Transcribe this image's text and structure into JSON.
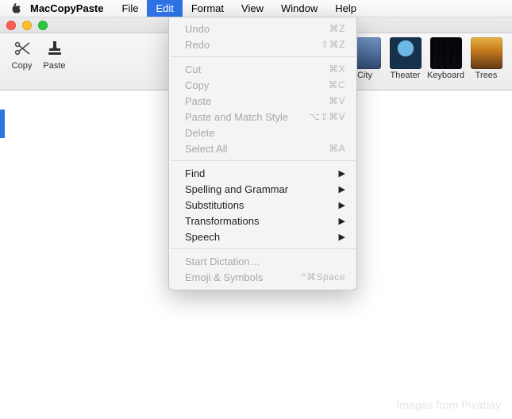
{
  "menubar": {
    "app_name": "MacCopyPaste",
    "items": [
      "File",
      "Edit",
      "Format",
      "View",
      "Window",
      "Help"
    ],
    "active_index": 1
  },
  "toolbar": {
    "copy_label": "Copy",
    "paste_label": "Paste",
    "thumbs": [
      {
        "label": "City"
      },
      {
        "label": "Theater"
      },
      {
        "label": "Keyboard"
      },
      {
        "label": "Trees"
      }
    ]
  },
  "dropdown": {
    "groups": [
      [
        {
          "label": "Undo",
          "shortcut": "⌘Z",
          "disabled": true
        },
        {
          "label": "Redo",
          "shortcut": "⇧⌘Z",
          "disabled": true
        }
      ],
      [
        {
          "label": "Cut",
          "shortcut": "⌘X",
          "disabled": true
        },
        {
          "label": "Copy",
          "shortcut": "⌘C",
          "disabled": true
        },
        {
          "label": "Paste",
          "shortcut": "⌘V",
          "disabled": true
        },
        {
          "label": "Paste and Match Style",
          "shortcut": "⌥⇧⌘V",
          "disabled": true
        },
        {
          "label": "Delete",
          "shortcut": "",
          "disabled": true
        },
        {
          "label": "Select All",
          "shortcut": "⌘A",
          "disabled": true
        }
      ],
      [
        {
          "label": "Find",
          "submenu": true
        },
        {
          "label": "Spelling and Grammar",
          "submenu": true
        },
        {
          "label": "Substitutions",
          "submenu": true
        },
        {
          "label": "Transformations",
          "submenu": true
        },
        {
          "label": "Speech",
          "submenu": true
        }
      ],
      [
        {
          "label": "Start Dictation…",
          "disabled": true
        },
        {
          "label": "Emoji & Symbols",
          "shortcut": "^⌘Space",
          "disabled": true
        }
      ]
    ]
  },
  "footer": {
    "watermark": "Images from Pixabay"
  }
}
